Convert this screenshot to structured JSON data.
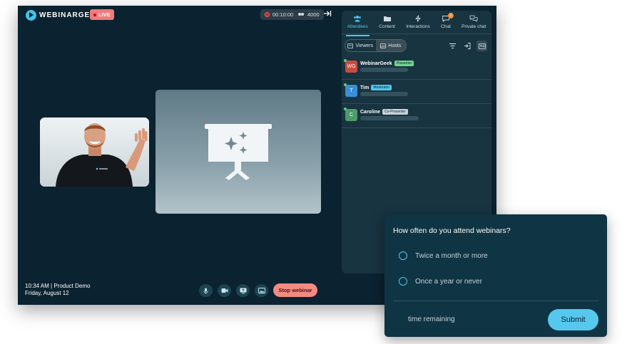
{
  "header": {
    "brand": "WEBINARGEEK",
    "live_label": "LIVE",
    "timer": "00:10:00",
    "viewer_count": "4000"
  },
  "footer": {
    "time_title": "10:34 AM | Product Demo",
    "date": "Friday, August 12",
    "stop_label": "Stop webinar"
  },
  "sidebar": {
    "tabs": [
      {
        "label": "Attendees",
        "icon": "people-icon",
        "active": true
      },
      {
        "label": "Content",
        "icon": "folder-icon"
      },
      {
        "label": "Interactions",
        "icon": "lightning-icon"
      },
      {
        "label": "Chat",
        "icon": "chat-icon",
        "badge": "2"
      },
      {
        "label": "Private chat",
        "icon": "private-chat-icon"
      }
    ],
    "toggle": {
      "viewers": "Viewers",
      "hosts": "Hosts"
    },
    "attendees": [
      {
        "initials": "WG",
        "name": "WebinarGeek",
        "role": "Presenter",
        "avatar_color": "#c94b3f",
        "role_color": "#6fd88a"
      },
      {
        "initials": "T",
        "name": "Tim",
        "role": "Moderator",
        "avatar_color": "#3b8fd6",
        "role_color": "#4fc7ee"
      },
      {
        "initials": "C",
        "name": "Caroline",
        "role": "Co-Presenter",
        "avatar_color": "#4e9a6a",
        "role_color": "#c7d3d8"
      }
    ]
  },
  "poll": {
    "question": "How often do you attend webinars?",
    "options": [
      "Twice a month or more",
      "Once a year or never"
    ],
    "time_label": "time remaining",
    "submit_label": "Submit"
  }
}
